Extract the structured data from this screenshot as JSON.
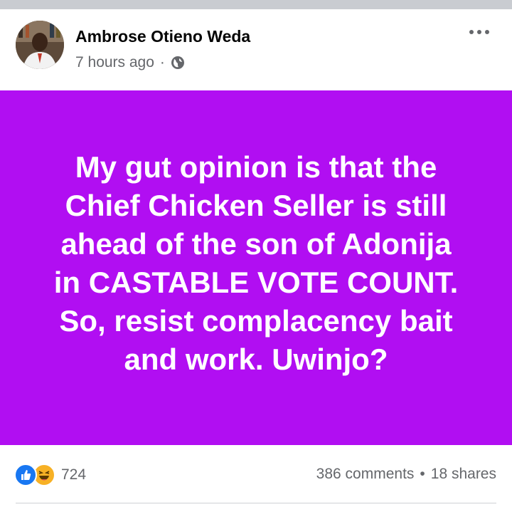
{
  "post": {
    "author": "Ambrose Otieno Weda",
    "time": "7 hours ago",
    "separator": "·",
    "privacy_icon": "globe-icon",
    "menu_icon": "more-options-icon",
    "background_color": "#b10ef2",
    "text": "My gut opinion is that the Chief Chicken Seller is still ahead of the son of Adonija in CASTABLE VOTE COUNT. So, resist complacency bait and work. Uwinjo?",
    "lines": [
      "My gut opinion is that the",
      "Chief Chicken Seller is still",
      "ahead of the son of Adonija",
      "in CASTABLE VOTE COUNT.",
      "So, resist complacency bait",
      "and work. Uwinjo?"
    ]
  },
  "engagement": {
    "reaction_icons": [
      "like-icon",
      "haha-icon"
    ],
    "reaction_count": "724",
    "comments": "386 comments",
    "dot": "•",
    "shares": "18 shares"
  },
  "colors": {
    "like": "#1877f2",
    "haha": "#f7b125",
    "text_secondary": "#65676b"
  }
}
